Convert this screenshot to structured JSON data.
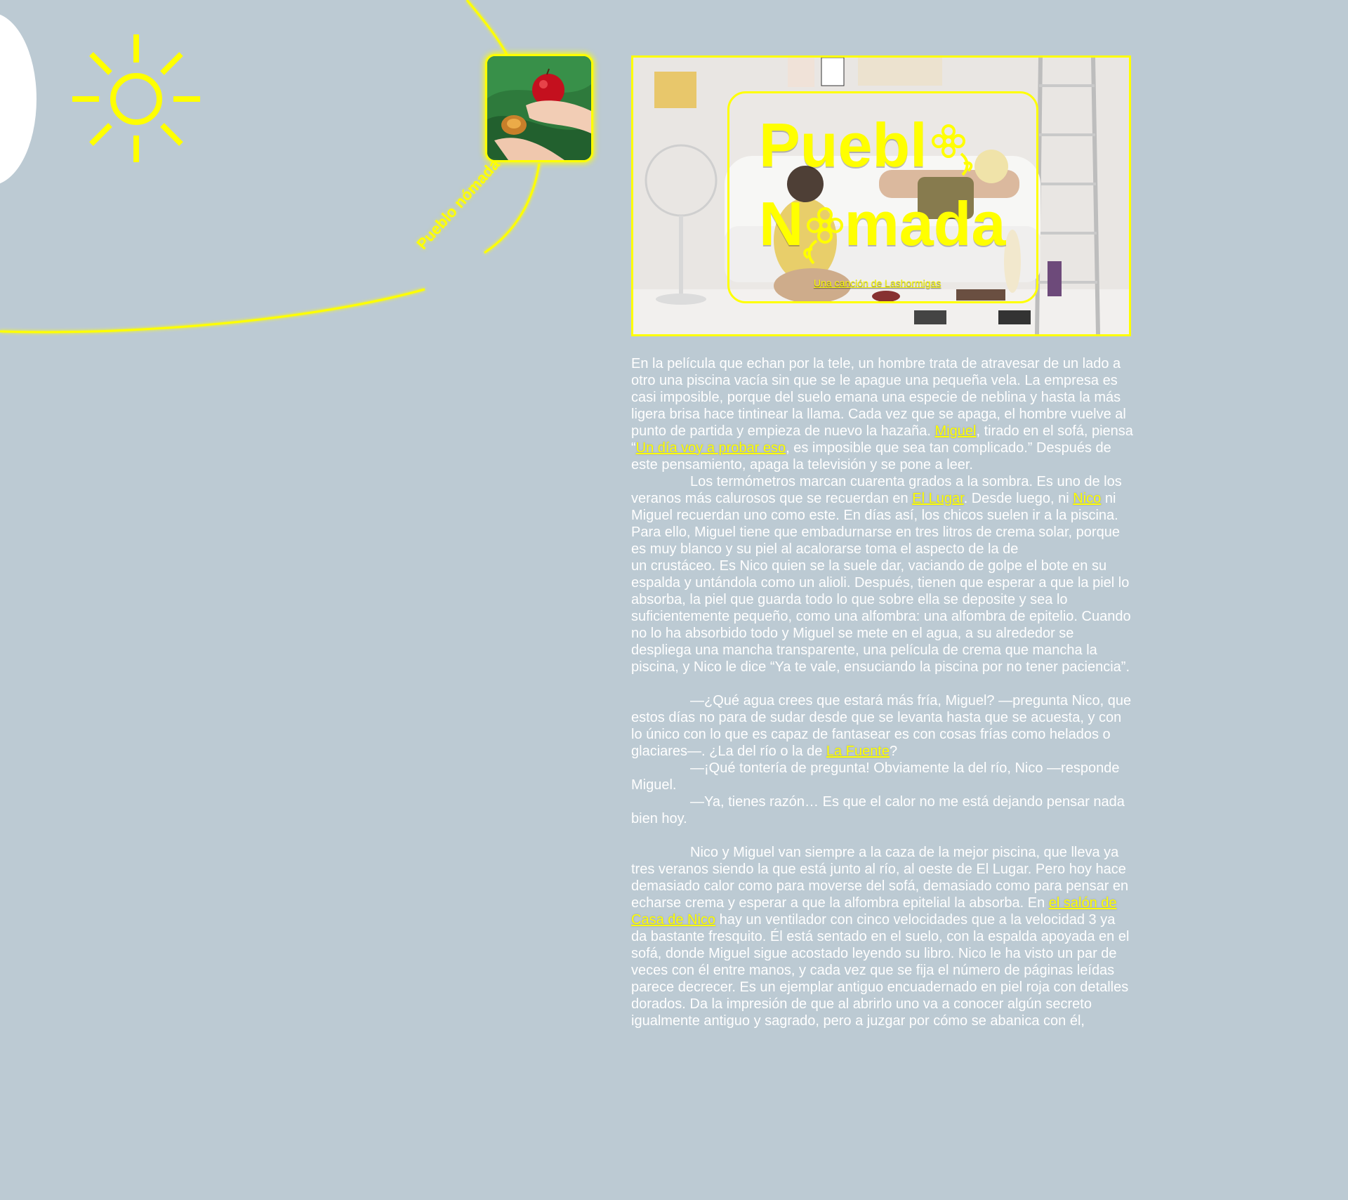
{
  "colors": {
    "background": "#bccad3",
    "accent": "#ffff00",
    "text": "#ffffff"
  },
  "decor": {
    "sun_icon": "sun-icon",
    "moon_icon": "moon-icon",
    "orbit_label": "Pueblo nómada"
  },
  "thumbnail": {
    "alt": "Mano con manzana roja y un vaso sobre fondo verde"
  },
  "hero": {
    "title_line1_a": "Puebl",
    "title_line1_b": "",
    "title_line2_a": "N",
    "title_line2_b": "mada",
    "flower_icon": "flower-icon",
    "subtitle_link": "Una canción de Lashormigas"
  },
  "story": {
    "p1": {
      "t1": "En la película que echan por la tele, un hombre trata de atravesar de un lado a otro una piscina vacía sin que se le apague una pequeña vela. La empresa es casi imposible, porque del suelo emana una especie de neblina y hasta la más ligera brisa hace tintinear la llama. Cada vez que se apaga, el hombre vuelve al punto de partida y empieza de nuevo la hazaña. ",
      "l1": "Miguel",
      "t2": ", tirado en el sofá, piensa “",
      "l2": "Un día voy a probar eso",
      "t3": ", es imposible que sea tan complicado.” Después de este pensamiento, apaga la televisión y se pone a leer."
    },
    "p2": {
      "t1": "Los termómetros marcan cuarenta grados a la sombra. Es uno de los",
      "t2": "veranos más calurosos que se recuerdan en ",
      "l1": "El Lugar",
      "t3": ". Desde luego, ni ",
      "l2": "Nico",
      "t4": " ni Miguel recuerdan uno como este. En días así, los chicos suelen ir a la piscina. Para ello, Miguel tiene que embadurnarse en tres litros de crema solar, porque es muy blanco y su piel al acalorarse toma el aspecto de la de",
      "t5": "un crustáceo. Es Nico quien se la suele dar, vaciando de golpe el bote en su espalda y untándola como un alioli. Después, tienen que esperar a que la piel lo absorba, la piel que guarda todo lo que sobre ella se deposite y sea lo suficientemente pequeño, como una alfombra: una alfombra de epitelio. Cuando no lo ha absorbido todo y Miguel se mete en el agua, a su alrededor se despliega una mancha transparente, una película de crema que mancha la piscina, y Nico le dice “Ya te vale, ensuciando la piscina por no tener paciencia”."
    },
    "p3": {
      "t1": "—¿Qué agua crees que estará más fría, Miguel? —pregunta Nico, que",
      "t2": "estos días no para de sudar desde que se levanta hasta que se acuesta, y con lo único con lo que es capaz de fantasear es con cosas frías como helados o glaciares—. ¿La del río o la de ",
      "l1": "La Fuente",
      "t3": "?"
    },
    "p4": {
      "t1": "—¡Qué tontería de pregunta! Obviamente la del río, Nico —responde",
      "t2": "Miguel."
    },
    "p5": {
      "t1": "—Ya, tienes razón… Es que el calor no me está dejando pensar nada",
      "t2": "bien hoy."
    },
    "p6": {
      "t1": "Nico y Miguel van siempre a la caza de la mejor piscina, que lleva ya",
      "t2": "tres veranos siendo la que está junto al río, al oeste de El Lugar. Pero hoy hace demasiado calor como para moverse del sofá, demasiado como para pensar en echarse crema y esperar a que la alfombra epitelial la absorba. En ",
      "l1": "el salón de Casa de Nico",
      "t3": " hay un ventilador con cinco velocidades que a la velocidad 3 ya da bastante fresquito. Él está sentado en el suelo, con la espalda apoyada en el sofá, donde Miguel sigue acostado leyendo su libro. Nico le ha visto un par de veces con él entre manos, y cada vez que se fija el número de páginas leídas parece decrecer. Es un ejemplar antiguo encuadernado en piel roja con detalles dorados. Da la impresión de que al abrirlo uno va a conocer algún secreto igualmente antiguo y sagrado, pero a juzgar por cómo se abanica con él,"
    }
  }
}
